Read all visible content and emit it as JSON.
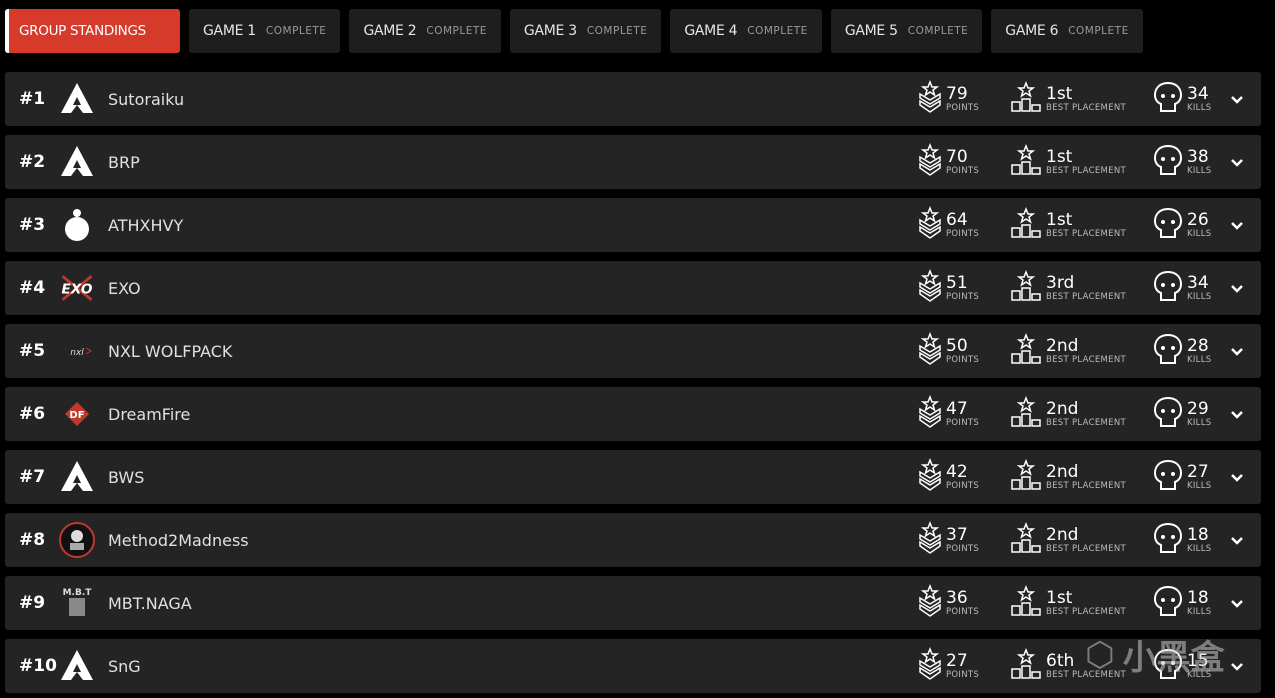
{
  "tabs": [
    {
      "label": "GROUP STANDINGS",
      "status": "",
      "active": true
    },
    {
      "label": "GAME 1",
      "status": "COMPLETE"
    },
    {
      "label": "GAME 2",
      "status": "COMPLETE"
    },
    {
      "label": "GAME 3",
      "status": "COMPLETE"
    },
    {
      "label": "GAME 4",
      "status": "COMPLETE"
    },
    {
      "label": "GAME 5",
      "status": "COMPLETE"
    },
    {
      "label": "GAME 6",
      "status": "COMPLETE"
    }
  ],
  "labels": {
    "points": "POINTS",
    "best_placement": "BEST PLACEMENT",
    "kills": "KILLS"
  },
  "accent": "#d63a2b",
  "teams": [
    {
      "rank": "#1",
      "name": "Sutoraiku",
      "logo": "apex-logo",
      "points": "79",
      "best": "1st",
      "kills": "34"
    },
    {
      "rank": "#2",
      "name": "BRP",
      "logo": "apex-logo",
      "points": "70",
      "best": "1st",
      "kills": "38"
    },
    {
      "rank": "#3",
      "name": "ATHXHVY",
      "logo": "athxhvy-logo",
      "points": "64",
      "best": "1st",
      "kills": "26"
    },
    {
      "rank": "#4",
      "name": "EXO",
      "logo": "exo-logo",
      "points": "51",
      "best": "3rd",
      "kills": "34"
    },
    {
      "rank": "#5",
      "name": "NXL WOLFPACK",
      "logo": "nxl-logo",
      "points": "50",
      "best": "2nd",
      "kills": "28"
    },
    {
      "rank": "#6",
      "name": "DreamFire",
      "logo": "dreamfire-logo",
      "points": "47",
      "best": "2nd",
      "kills": "29"
    },
    {
      "rank": "#7",
      "name": "BWS",
      "logo": "apex-logo",
      "points": "42",
      "best": "2nd",
      "kills": "27"
    },
    {
      "rank": "#8",
      "name": "Method2Madness",
      "logo": "m2m-logo",
      "points": "37",
      "best": "2nd",
      "kills": "18"
    },
    {
      "rank": "#9",
      "name": "MBT.NAGA",
      "logo": "mbt-logo",
      "points": "36",
      "best": "1st",
      "kills": "18"
    },
    {
      "rank": "#10",
      "name": "SnG",
      "logo": "apex-logo",
      "points": "27",
      "best": "6th",
      "kills": "15"
    }
  ],
  "watermark": "小黑盒"
}
